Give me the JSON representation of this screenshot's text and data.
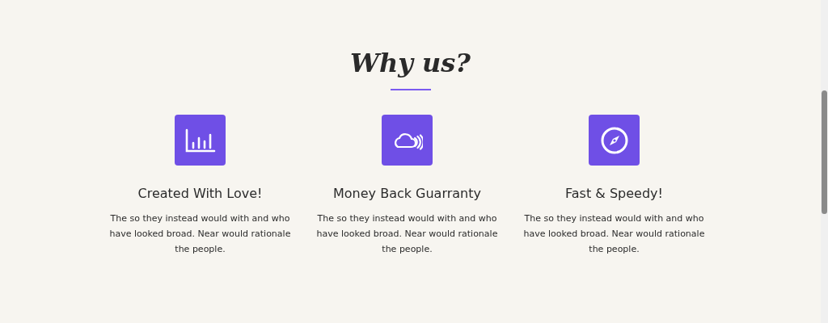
{
  "heading": "Why us?",
  "features": [
    {
      "kind": "chart",
      "title": "Created With Love!",
      "text": "The so they instead would with and who have looked broad. Near would rationale the people."
    },
    {
      "kind": "cloud",
      "title": "Money Back Guarranty",
      "text": "The so they instead would with and who have looked broad. Near would rationale the people."
    },
    {
      "kind": "compass",
      "title": "Fast & Speedy!",
      "text": "The so they instead would with and who have looked broad. Near would rationale the people."
    }
  ]
}
